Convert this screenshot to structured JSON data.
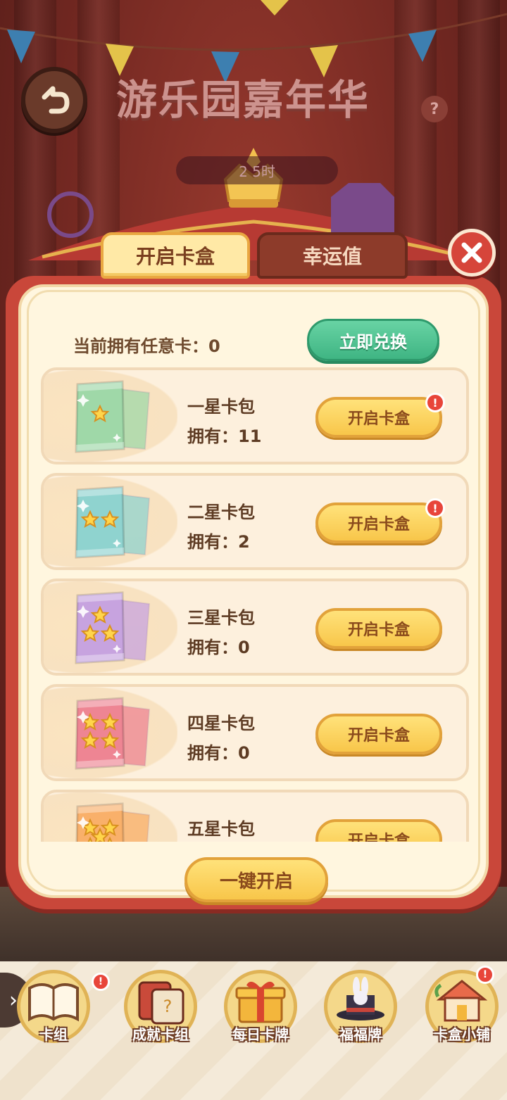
{
  "header": {
    "title": "游乐园嘉年华",
    "timer": "2 5时",
    "help_label": "?"
  },
  "tabs": [
    {
      "label": "开启卡盒",
      "active": true
    },
    {
      "label": "幸运值",
      "active": false
    }
  ],
  "owned_wildcard": {
    "label": "当前拥有任意卡：0",
    "exchange_label": "立即兑换"
  },
  "packs": [
    {
      "name": "一星卡包",
      "count": "拥有：11",
      "button": "开启卡盒",
      "badge": "!",
      "color": "#9fd8a8",
      "stars": 1
    },
    {
      "name": "二星卡包",
      "count": "拥有：2",
      "button": "开启卡盒",
      "badge": "!",
      "color": "#8fd3cf",
      "stars": 2
    },
    {
      "name": "三星卡包",
      "count": "拥有：0",
      "button": "开启卡盒",
      "badge": "",
      "color": "#c7a3df",
      "stars": 3
    },
    {
      "name": "四星卡包",
      "count": "拥有：0",
      "button": "开启卡盒",
      "badge": "",
      "color": "#ee8593",
      "stars": 4
    },
    {
      "name": "五星卡包",
      "count": "",
      "button": "开启卡盒",
      "badge": "",
      "color": "#f9b06a",
      "stars": 5
    }
  ],
  "open_all_label": "一键开启",
  "bottom_nav": [
    {
      "label": "卡组",
      "icon": "book-icon",
      "badge": "!"
    },
    {
      "label": "成就卡组",
      "icon": "card-stack-icon",
      "badge": ""
    },
    {
      "label": "每日卡牌",
      "icon": "gift-box-icon",
      "badge": ""
    },
    {
      "label": "福福牌",
      "icon": "magic-hat-icon",
      "badge": ""
    },
    {
      "label": "卡盒小铺",
      "icon": "shop-house-icon",
      "badge": "!"
    }
  ],
  "colors": {
    "accent_gold": "#f8c64a",
    "accent_green": "#3fb583",
    "modal_red": "#c9473a",
    "alert_red": "#e8453a"
  }
}
